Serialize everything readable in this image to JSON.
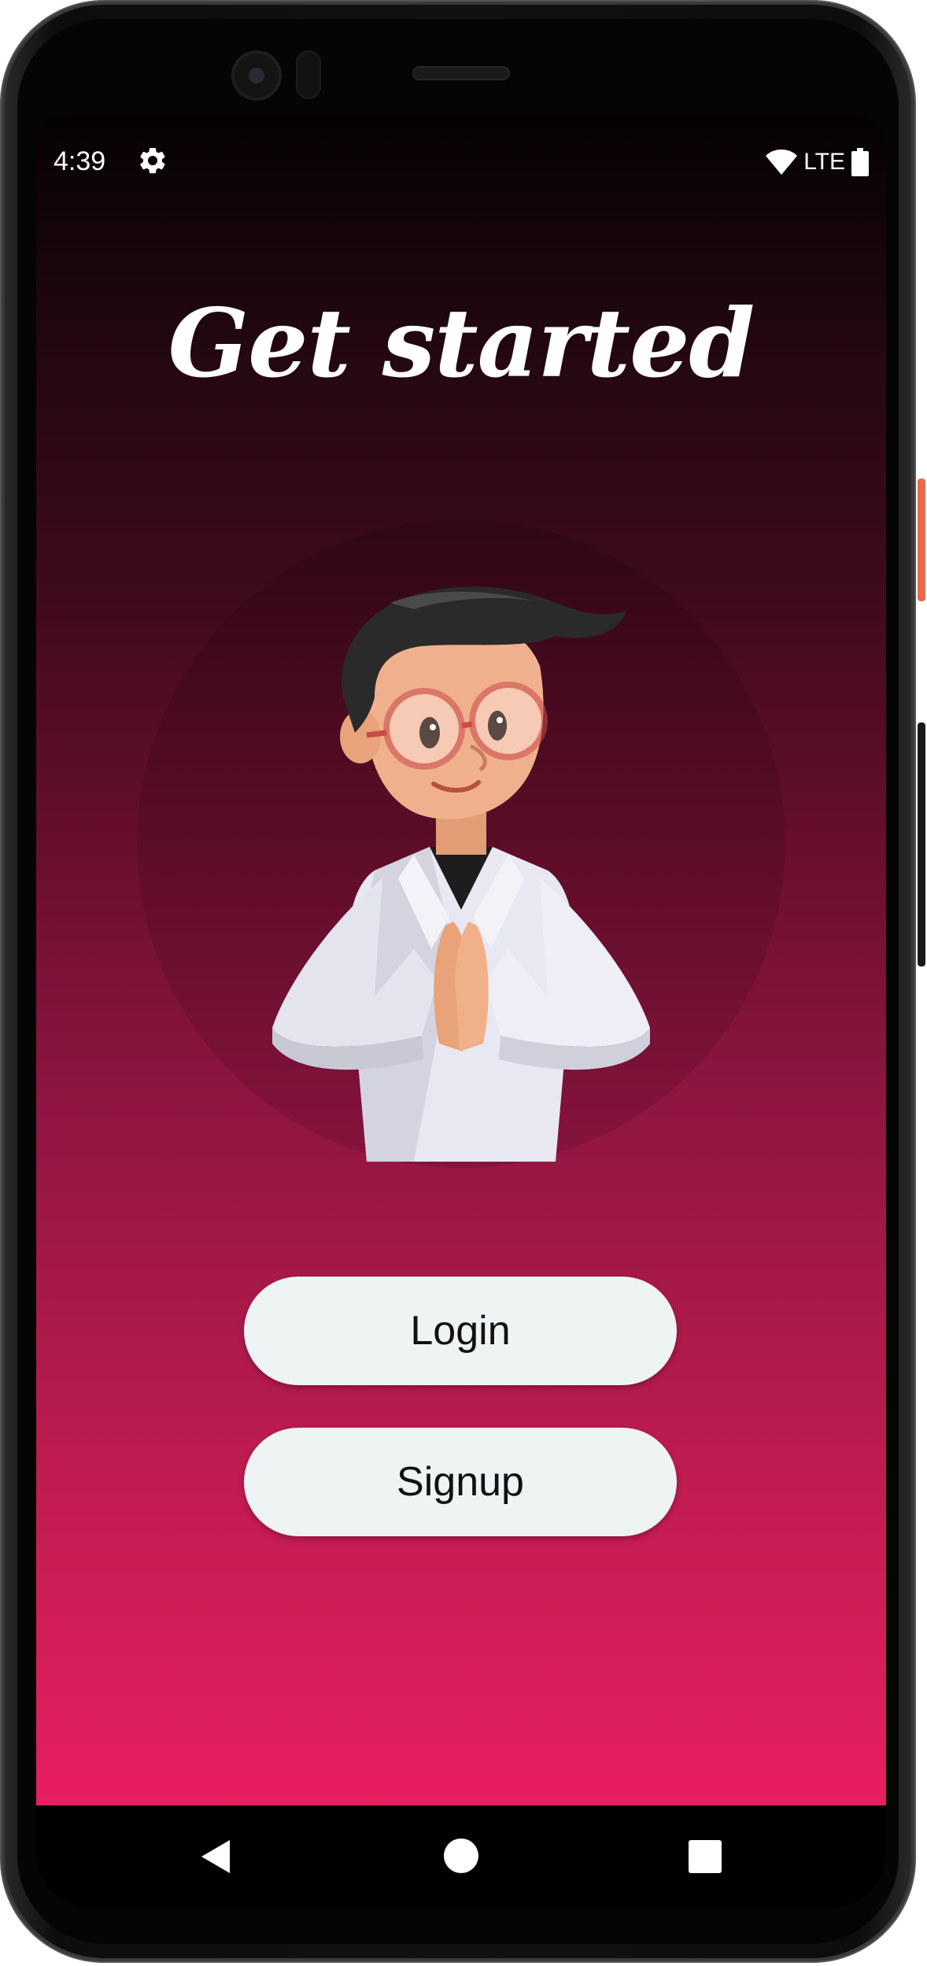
{
  "status_bar": {
    "time": "4:39",
    "network": "LTE",
    "icons": [
      "gear-icon",
      "wifi-icon",
      "battery-icon"
    ]
  },
  "main": {
    "title": "Get started",
    "illustration": "doctor-greeting-illustration",
    "login_label": "Login",
    "signup_label": "Signup"
  },
  "nav_bar": {
    "icons": [
      "back-icon",
      "home-icon",
      "recents-icon"
    ]
  },
  "colors": {
    "gradient_top": "#050203",
    "gradient_bottom": "#e81e61",
    "button_bg": "#eef3f4",
    "button_text": "#111111"
  }
}
